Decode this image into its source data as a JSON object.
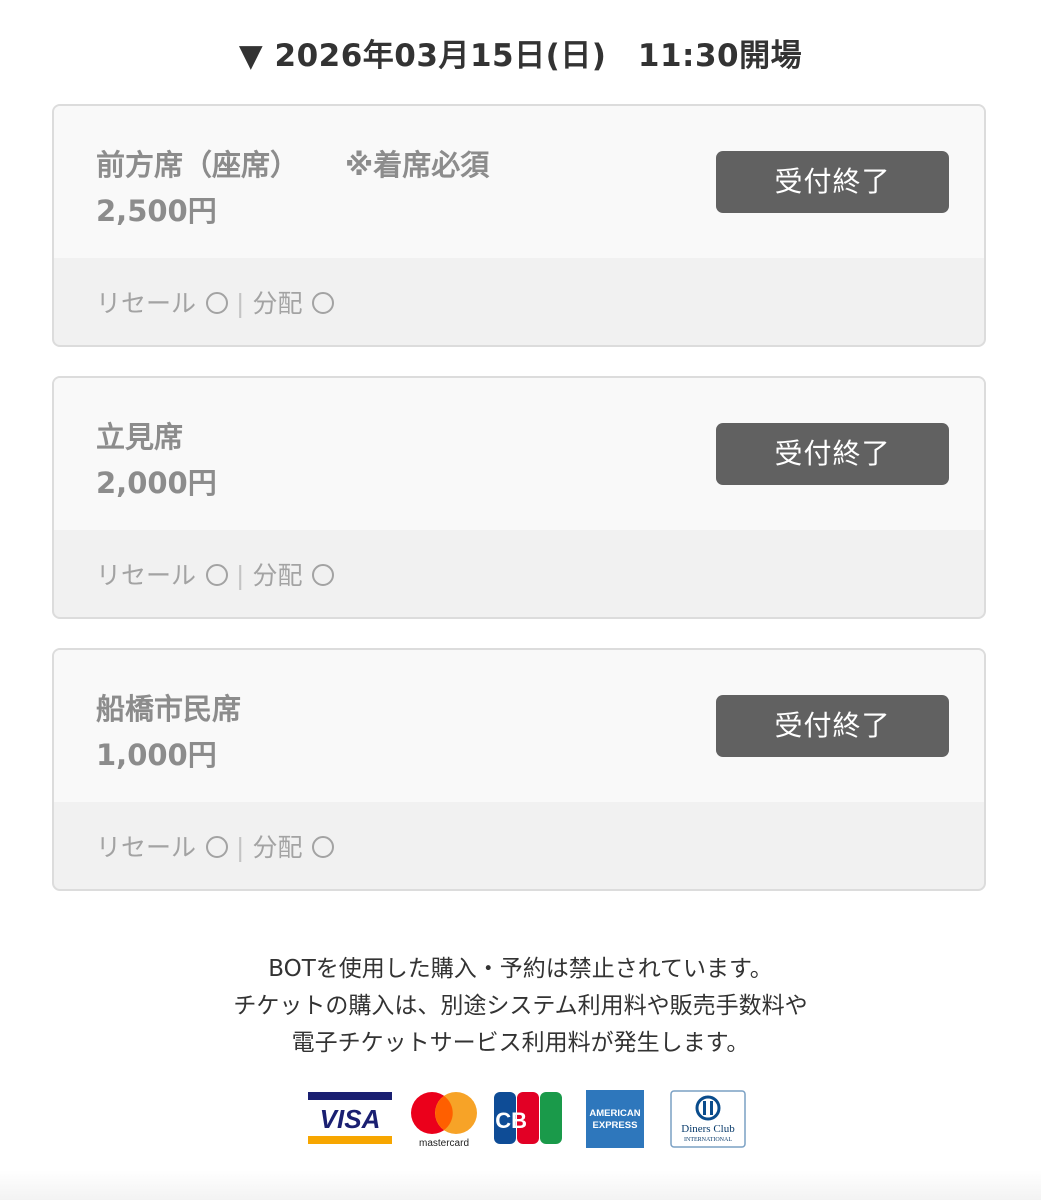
{
  "event": {
    "date_line": "▼ 2026年03月15日(日)　11:30開場"
  },
  "tickets": [
    {
      "name": "前方席（座席）",
      "note": "※着席必須",
      "price": "2,500円",
      "status_button": "受付終了",
      "resale_label": "リセール",
      "separator": "|",
      "distribution_label": "分配"
    },
    {
      "name": "立見席",
      "note": "",
      "price": "2,000円",
      "status_button": "受付終了",
      "resale_label": "リセール",
      "separator": "|",
      "distribution_label": "分配"
    },
    {
      "name": "船橋市民席",
      "note": "",
      "price": "1,000円",
      "status_button": "受付終了",
      "resale_label": "リセール",
      "separator": "|",
      "distribution_label": "分配"
    }
  ],
  "notice": {
    "line1": "BOTを使用した購入・予約は禁止されています。",
    "line2": "チケットの購入は、別途システム利用料や販売手数料や",
    "line3": "電子チケットサービス利用料が発生します。"
  },
  "payment_brands": {
    "visa": "VISA",
    "mastercard": "mastercard",
    "jcb": "JCB",
    "amex_line1": "AMERICAN",
    "amex_line2": "EXPRESS",
    "diners_line1": "Diners Club",
    "diners_line2": "INTERNATIONAL"
  },
  "colors": {
    "button_bg": "#616161",
    "card_top_bg": "#f9f9f9",
    "card_bottom_bg": "#f1f1f1",
    "muted_text": "#8c8c8c",
    "visa_blue": "#1a1f71",
    "visa_gold": "#f7a600",
    "mc_red": "#eb001b",
    "mc_yellow": "#f79e1b",
    "amex_blue": "#2e77bc"
  }
}
